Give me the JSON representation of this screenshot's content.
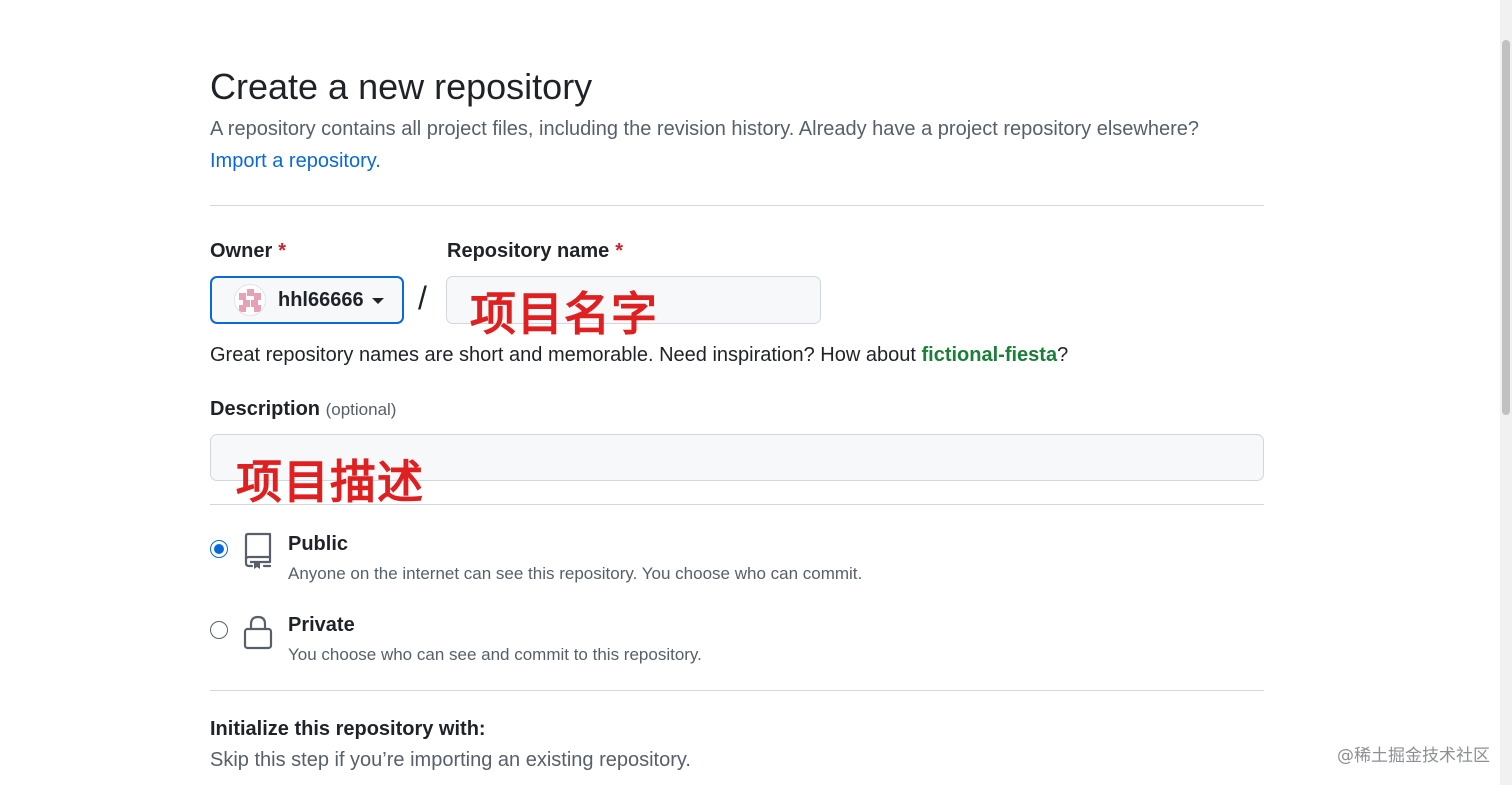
{
  "header": {
    "title": "Create a new repository",
    "subtitle": "A repository contains all project files, including the revision history. Already have a project repository elsewhere?",
    "import_link": "Import a repository."
  },
  "owner": {
    "label": "Owner",
    "required_mark": "*",
    "value": "hhl66666"
  },
  "separator": "/",
  "repo_name": {
    "label": "Repository name",
    "required_mark": "*",
    "value": "",
    "annotation": "项目名字"
  },
  "hint": {
    "prefix": "Great repository names are short and memorable. Need inspiration? How about ",
    "suggestion": "fictional-fiesta",
    "suffix": "?"
  },
  "description": {
    "label": "Description",
    "optional": "(optional)",
    "value": "",
    "annotation": "项目描述"
  },
  "visibility": {
    "selected": "public",
    "options": [
      {
        "id": "public",
        "title": "Public",
        "desc": "Anyone on the internet can see this repository. You choose who can commit.",
        "icon": "repo-icon"
      },
      {
        "id": "private",
        "title": "Private",
        "desc": "You choose who can see and commit to this repository.",
        "icon": "lock-icon"
      }
    ]
  },
  "initialize": {
    "title": "Initialize this repository with:",
    "desc": "Skip this step if you’re importing an existing repository."
  },
  "watermark": "@稀土掘金技术社区",
  "colors": {
    "accent": "#0969da",
    "required": "#cf222e",
    "suggestion": "#1a7f37",
    "annotation": "#e02020"
  }
}
